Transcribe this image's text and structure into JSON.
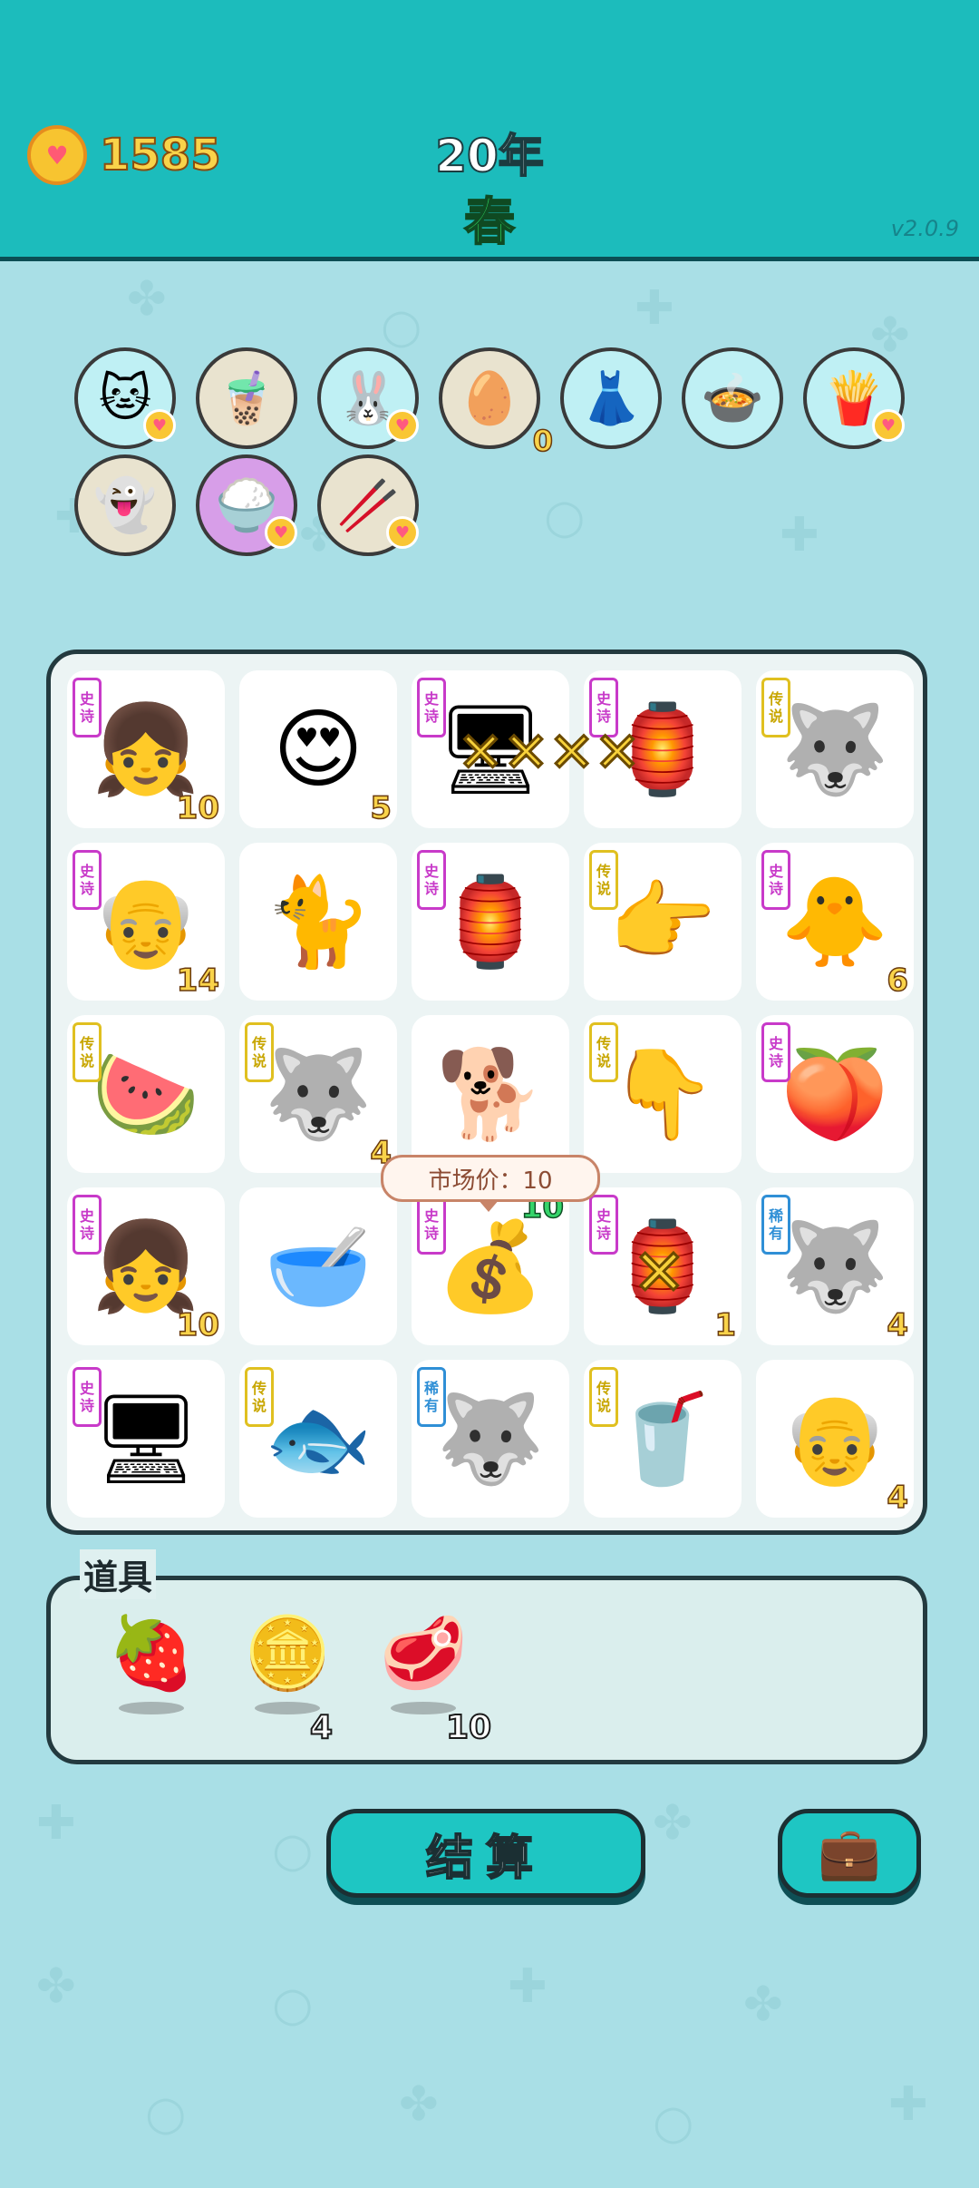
{
  "header": {
    "coins": "1585",
    "year": "20年",
    "season": "春",
    "version": "v2.0.9"
  },
  "top_icons": [
    {
      "icon": "cat-lighter-icon",
      "glyph": "🐱",
      "bg": "#bff0f4",
      "heart": true,
      "count": ""
    },
    {
      "icon": "bubble-tea-icon",
      "glyph": "🧋",
      "bg": "#e9e3cf",
      "heart": false,
      "count": ""
    },
    {
      "icon": "rabbit-icon",
      "glyph": "🐰",
      "bg": "#bff0f4",
      "heart": true,
      "count": ""
    },
    {
      "icon": "egg-tray-icon",
      "glyph": "🥚",
      "bg": "#e9e3cf",
      "heart": false,
      "count": "0"
    },
    {
      "icon": "pleated-skirt-icon",
      "glyph": "👗",
      "bg": "#bff0f4",
      "heart": false,
      "count": ""
    },
    {
      "icon": "rice-cooker-duck-icon",
      "glyph": "🍲",
      "bg": "#bff0f4",
      "heart": false,
      "count": ""
    },
    {
      "icon": "french-fries-icon",
      "glyph": "🍟",
      "bg": "#bff0f4",
      "heart": true,
      "count": ""
    },
    {
      "icon": "ghost-icon",
      "glyph": "👻",
      "bg": "#e9e3cf",
      "heart": false,
      "count": ""
    },
    {
      "icon": "rice-bowl-icon",
      "glyph": "🍚",
      "bg": "#d79ee8",
      "heart": true,
      "count": ""
    },
    {
      "icon": "chopsticks-icon",
      "glyph": "🥢",
      "bg": "#e9e3cf",
      "heart": true,
      "count": ""
    }
  ],
  "board": [
    {
      "icon": "braided-girl-icon",
      "glyph": "👧",
      "tag": "史诗",
      "tag_class": "epic",
      "count": "10"
    },
    {
      "icon": "heart-eyes-man-icon",
      "glyph": "😍",
      "tag": "",
      "tag_class": "",
      "count": "5"
    },
    {
      "icon": "graphics-card-icon",
      "glyph": "🖥",
      "tag": "史诗",
      "tag_class": "epic",
      "count": ""
    },
    {
      "icon": "rabbit-house-icon",
      "glyph": "🏮",
      "tag": "史诗",
      "tag_class": "epic",
      "count": ""
    },
    {
      "icon": "husky-king-icon",
      "glyph": "🐺",
      "tag": "传说",
      "tag_class": "legend",
      "count": ""
    },
    {
      "icon": "heart-grandpa-icon",
      "glyph": "👴",
      "tag": "史诗",
      "tag_class": "epic",
      "count": "14"
    },
    {
      "icon": "yellow-cat-icon",
      "glyph": "🐈",
      "tag": "",
      "tag_class": "",
      "count": ""
    },
    {
      "icon": "rabbit-house-icon",
      "glyph": "🏮",
      "tag": "史诗",
      "tag_class": "epic",
      "count": ""
    },
    {
      "icon": "pointing-hand-icon",
      "glyph": "👉",
      "tag": "传说",
      "tag_class": "legend",
      "count": ""
    },
    {
      "icon": "yellow-chick-icon",
      "glyph": "🐥",
      "tag": "史诗",
      "tag_class": "epic",
      "count": "6"
    },
    {
      "icon": "watermelon-icon",
      "glyph": "🍉",
      "tag": "传说",
      "tag_class": "legend",
      "count": ""
    },
    {
      "icon": "husky-king-icon",
      "glyph": "🐺",
      "tag": "传说",
      "tag_class": "legend",
      "count": "4"
    },
    {
      "icon": "brown-dog-icon",
      "glyph": "🐕",
      "tag": "",
      "tag_class": "",
      "count": ""
    },
    {
      "icon": "hand-down-icon",
      "glyph": "👇",
      "tag": "传说",
      "tag_class": "legend",
      "count": ""
    },
    {
      "icon": "peach-icon",
      "glyph": "🍑",
      "tag": "史诗",
      "tag_class": "epic",
      "count": ""
    },
    {
      "icon": "braided-girl-icon",
      "glyph": "👧",
      "tag": "史诗",
      "tag_class": "epic",
      "count": "10"
    },
    {
      "icon": "porcelain-bowl-icon",
      "glyph": "🥣",
      "tag": "",
      "tag_class": "",
      "count": ""
    },
    {
      "icon": "coin-recycle-icon",
      "glyph": "💰",
      "tag": "史诗",
      "tag_class": "epic",
      "count": "10",
      "count_green": true
    },
    {
      "icon": "rabbit-house-icon",
      "glyph": "🏮",
      "tag": "史诗",
      "tag_class": "epic",
      "count": "1"
    },
    {
      "icon": "husky-icon",
      "glyph": "🐺",
      "tag": "稀有",
      "tag_class": "rare",
      "count": "4"
    },
    {
      "icon": "graphics-card-icon",
      "glyph": "🖥",
      "tag": "史诗",
      "tag_class": "epic",
      "count": ""
    },
    {
      "icon": "koi-fish-icon",
      "glyph": "🐟",
      "tag": "传说",
      "tag_class": "legend",
      "count": ""
    },
    {
      "icon": "husky-icon",
      "glyph": "🐺",
      "tag": "稀有",
      "tag_class": "rare",
      "count": ""
    },
    {
      "icon": "bubble-tea-cup-icon",
      "glyph": "🥤",
      "tag": "传说",
      "tag_class": "legend",
      "count": ""
    },
    {
      "icon": "glasses-grandpa-icon",
      "glyph": "👴",
      "tag": "",
      "tag_class": "",
      "count": "4"
    }
  ],
  "tooltip": "市场价：10",
  "tools": {
    "title": "道具",
    "items": [
      {
        "icon": "bayberry-icon",
        "glyph": "🍓",
        "count": ""
      },
      {
        "icon": "dollar-coin-icon",
        "glyph": "🪙",
        "count": "4"
      },
      {
        "icon": "pork-liver-icon",
        "glyph": "🥩",
        "count": "10"
      }
    ]
  },
  "buttons": {
    "settle": "结算",
    "bag_icon": "briefcase-icon"
  },
  "colors": {
    "header_bg": "#1cbcbc",
    "page_bg": "#a9dfe6",
    "coin_text": "#f9d34a",
    "season_text": "#2ed35c",
    "epic_tag": "#c83ac9",
    "legend_tag": "#e0c020",
    "rare_tag": "#2f8fd6"
  }
}
